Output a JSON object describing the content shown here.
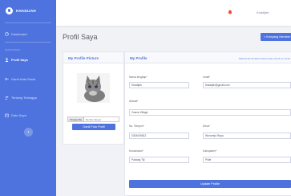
{
  "brand": {
    "name": "KHADIJAH"
  },
  "sidebar": {
    "dashboard": "Dashboard",
    "heading": "PENGATURAN",
    "items": [
      {
        "label": "Profil Saya",
        "icon": "user-icon"
      },
      {
        "label": "Ganti Kata Sandi",
        "icon": "key-icon"
      },
      {
        "label": "Tentang Tetangga",
        "icon": "users-icon"
      },
      {
        "label": "Data Saya",
        "icon": "calendar-icon"
      }
    ],
    "toggle": "‹"
  },
  "topbar": {
    "user_name": "Khadijah"
  },
  "page": {
    "title": "Profil Saya",
    "back_button": "< Kenyang Member"
  },
  "picture_card": {
    "title": "My Profile Picture",
    "choose_file": "Choose file",
    "no_file": "No file chosen",
    "button": "Ganti Foto Profil"
  },
  "profile_card": {
    "title": "My Profile",
    "subtitle": "TERAKHIR DIUBAH PADA 2021-09-05 21:23:50",
    "fields": {
      "nama_lengkap": {
        "label": "Nama lengkap*",
        "value": "Khadijah"
      },
      "email": {
        "label": "email*",
        "value": "khadijah@gmail.com"
      },
      "alamat": {
        "label": "Alamat*",
        "value": "Guava Village"
      },
      "no_telp": {
        "label": "No. Telepon*",
        "value": "0304005812"
      },
      "desa": {
        "label": "Desa*",
        "value": "Wonorejo Raya"
      },
      "kecamatan": {
        "label": "Kecamatan*",
        "value": "Padang Tiji"
      },
      "kabupaten": {
        "label": "Kabupaten*",
        "value": "Pidie"
      }
    },
    "update_button": "Update Profile"
  },
  "colors": {
    "primary": "#4e73df",
    "bell": "#e74a3b"
  }
}
